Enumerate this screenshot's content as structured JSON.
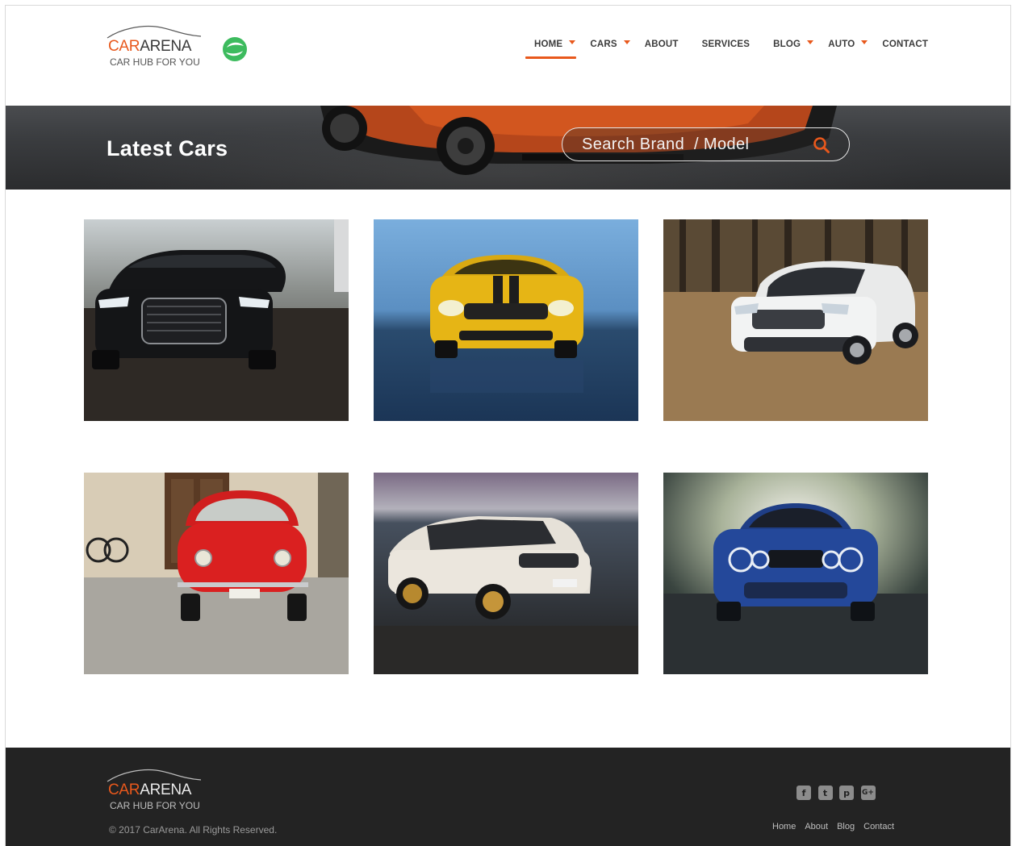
{
  "header": {
    "logo": {
      "brand_accent": "CAR",
      "brand_rest": "ARENA",
      "tagline": "CAR HUB FOR YOU"
    },
    "nav": [
      {
        "label": "HOME",
        "dropdown": true,
        "active": true
      },
      {
        "label": "CARS",
        "dropdown": true
      },
      {
        "label": "ABOUT",
        "dropdown": false
      },
      {
        "label": "SERVICES",
        "dropdown": false
      },
      {
        "label": "BLOG",
        "dropdown": true
      },
      {
        "label": "AUTO",
        "dropdown": true
      },
      {
        "label": "CONTACT",
        "dropdown": false
      }
    ]
  },
  "banner": {
    "title": "Latest Cars",
    "search_placeholder": "Search Brand  / Model"
  },
  "gallery": {
    "cars": [
      {
        "alt": "Black sedan"
      },
      {
        "alt": "Yellow sports car"
      },
      {
        "alt": "White SUV"
      },
      {
        "alt": "Red vintage car"
      },
      {
        "alt": "White crossover"
      },
      {
        "alt": "Blue sedan"
      }
    ]
  },
  "footer": {
    "logo": {
      "brand_accent": "CAR",
      "brand_rest": "ARENA",
      "tagline": "CAR HUB FOR YOU"
    },
    "copyright": "© 2017 CarArena. All Rights Reserved.",
    "social": [
      "facebook-icon",
      "twitter-icon",
      "pinterest-icon",
      "google-plus-icon"
    ],
    "links": [
      "Home",
      "About",
      "Blog",
      "Contact"
    ]
  },
  "colors": {
    "accent": "#e8581c",
    "footer_bg": "#232323",
    "text": "#3b3b3b"
  }
}
